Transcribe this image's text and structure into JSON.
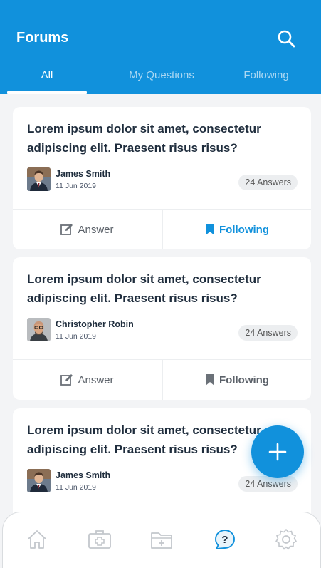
{
  "header": {
    "title": "Forums",
    "search_icon": "search-icon"
  },
  "tabs": [
    {
      "label": "All",
      "active": true
    },
    {
      "label": "My Questions",
      "active": false
    },
    {
      "label": "Following",
      "active": false
    }
  ],
  "posts": [
    {
      "title": "Lorem ipsum dolor sit amet, consectetur adipiscing elit. Praesent risus risus?",
      "author": "James Smith",
      "date": "11 Jun 2019",
      "answers": "24 Answers",
      "answer_label": "Answer",
      "following_label": "Following",
      "following_active": true
    },
    {
      "title": "Lorem ipsum dolor sit amet, consectetur adipiscing elit. Praesent risus risus?",
      "author": "Christopher Robin",
      "date": "11 Jun 2019",
      "answers": "24 Answers",
      "answer_label": "Answer",
      "following_label": "Following",
      "following_active": false
    },
    {
      "title": "Lorem ipsum dolor sit amet, consectetur adipiscing elit. Praesent risus risus?",
      "author": "James Smith",
      "date": "11 Jun 2019",
      "answers": "24 Answers"
    }
  ],
  "fab": {
    "icon": "plus-icon"
  },
  "bottom_nav": [
    {
      "icon": "home-icon",
      "active": false
    },
    {
      "icon": "medical-kit-icon",
      "active": false
    },
    {
      "icon": "folder-add-icon",
      "active": false
    },
    {
      "icon": "help-chat-icon",
      "active": true
    },
    {
      "icon": "gear-icon",
      "active": false
    }
  ],
  "colors": {
    "primary": "#1191dc",
    "background": "#f3f4f6",
    "card": "#ffffff",
    "text_dark": "#1f2d3d",
    "icon_inactive": "#c3c7cc"
  }
}
